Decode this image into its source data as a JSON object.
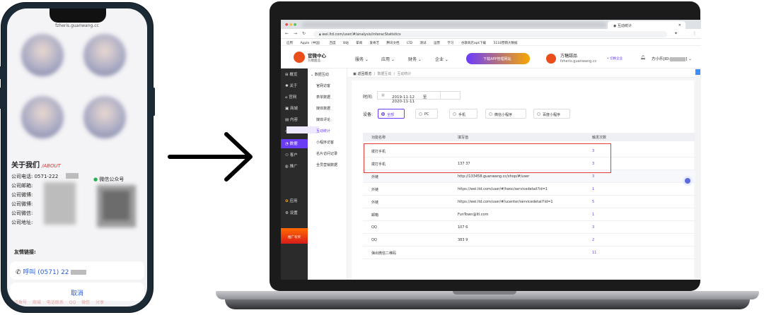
{
  "phone": {
    "url": "fzheris.guanwang.cc",
    "about_title": "关于我们",
    "about_en": "/ABOUT",
    "info_lines": [
      "公司电话: 0571-222",
      "公司邮箱:",
      "公司微博:",
      "公司微博:",
      "公司微信:",
      "公司地址:"
    ],
    "wechat_label": "微信公众号",
    "friend_links": "友情链接:",
    "call_label": "呼叫 (0571) 22",
    "cancel_label": "取消",
    "bottom_nav": "电话拨号 商城 电话联系 QQ 微信 分享"
  },
  "browser": {
    "tab_title": "互动统计",
    "url": "wei.ltd.com/user/#/analysis/interacStatistics",
    "bookmarks": [
      "应用",
      "Apple（中国）",
      "百度",
      "B站",
      "掌阅",
      "爱奇艺",
      "腾讯文档",
      "LTD",
      "测试",
      "运营",
      "学习",
      "谷歌商店apk下载",
      "5118营销大数据"
    ]
  },
  "header": {
    "brand": "官微中心",
    "brand_sub": "方糖甜品",
    "nav": [
      "服务",
      "应用",
      "财务",
      "企业"
    ],
    "promo": "下载APP管理网站",
    "company": "方糖甜品",
    "company_domain": "fzheris.guanwang.cc",
    "switch": "• 切换企业",
    "user": "方小乐[ID:"
  },
  "sidebar": {
    "items": [
      "概览",
      "关于",
      "官网",
      "商城",
      "内容",
      "媒体",
      "数据",
      "客户",
      "推广"
    ],
    "bottom": [
      "应用",
      "设置"
    ],
    "promo": "推广有奖"
  },
  "subnav": {
    "group": "数据互动",
    "items": [
      "官网访客",
      "表单数据",
      "媒体数据",
      "媒体评论",
      "互动统计",
      "小程序访客",
      "名片访问记录",
      "全员营销数据"
    ]
  },
  "breadcrumb": {
    "back": "返回概览",
    "level1": "数据互动",
    "level2": "互动统计"
  },
  "filters": {
    "time_label": "时间:",
    "date_from": "2019-11-12",
    "date_sep": "至",
    "date_to": "2020-11-11",
    "device_label": "设备:",
    "devices": [
      "全部",
      "PC",
      "手机",
      "微信小程序",
      "百度小程序"
    ]
  },
  "table": {
    "headers": [
      "功能名称",
      "填写值",
      "触发次数"
    ],
    "rows": [
      {
        "name": "拨打手机",
        "value": "",
        "count": "3"
      },
      {
        "name": "拨打手机",
        "value": "137      37",
        "count": "3"
      },
      {
        "name": "外链",
        "value": "http://133458.guanwang.cc/shop/#/user",
        "count": "3"
      },
      {
        "name": "外链",
        "value": "https://wei.ltd.com/user/#/twoc/servicedetail?id=1",
        "count": "1"
      },
      {
        "name": "外链",
        "value": "https://wei.ltd.com/user/#/ucenter/servicedetail?id=1",
        "count": "5"
      },
      {
        "name": "邮箱",
        "value": "FunTown@ltl.com",
        "count": "1"
      },
      {
        "name": "QQ",
        "value": "107        6",
        "count": "3"
      },
      {
        "name": "QQ",
        "value": "383       9",
        "count": "2"
      },
      {
        "name": "弹出微信二维码",
        "value": "",
        "count": "11"
      }
    ]
  },
  "colors": {
    "accent": "#6a3cf5",
    "highlight_box": "#e23b3b",
    "sidebar_bg": "#2b2b2b"
  }
}
